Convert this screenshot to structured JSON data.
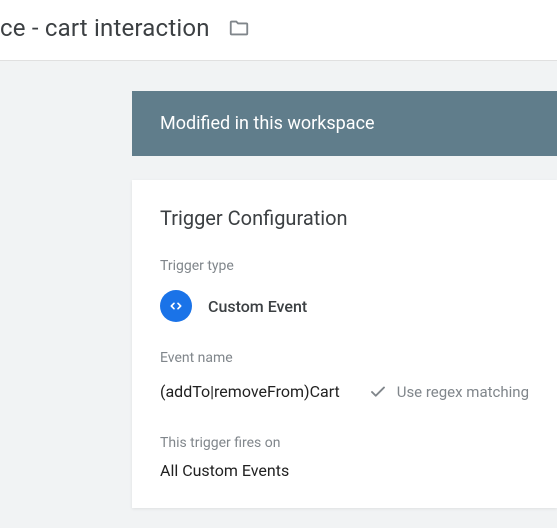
{
  "header": {
    "title": "ce - cart interaction"
  },
  "banner": {
    "text": "Modified in this workspace"
  },
  "card": {
    "title": "Trigger Configuration",
    "triggerTypeLabel": "Trigger type",
    "triggerTypeName": "Custom Event",
    "eventNameLabel": "Event name",
    "eventNameValue": "(addTo|removeFrom)Cart",
    "regexLabel": "Use regex matching",
    "firesOnLabel": "This trigger fires on",
    "firesOnValue": "All Custom Events"
  }
}
